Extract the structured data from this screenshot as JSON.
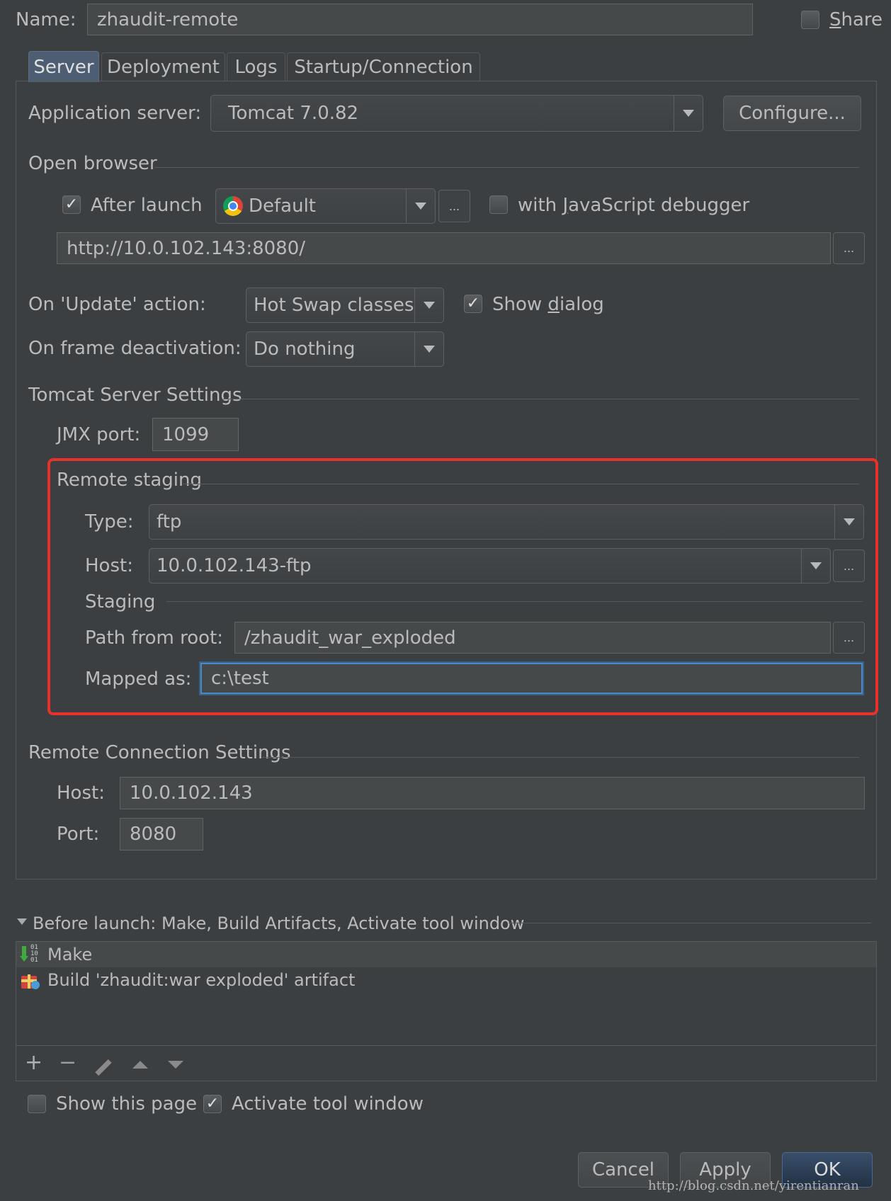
{
  "name": {
    "label": "Name:",
    "value": "zhaudit-remote"
  },
  "share": {
    "label_first": "S",
    "label_rest": "hare",
    "checked": false
  },
  "tabs": [
    {
      "label": "Server",
      "active": true
    },
    {
      "label": "Deployment",
      "active": false
    },
    {
      "label": "Logs",
      "active": false
    },
    {
      "label": "Startup/Connection",
      "active": false
    }
  ],
  "app_server": {
    "label": "Application server:",
    "value": "Tomcat 7.0.82",
    "configure_label": "Configure..."
  },
  "open_browser": {
    "section_label": "Open browser",
    "after_launch_label": "After launch",
    "after_launch_checked": true,
    "browser_value": "Default",
    "browser_icon": "chrome-icon",
    "ellipsis": "...",
    "js_debugger_pre": "with ",
    "js_debugger_u": "J",
    "js_debugger_post": "avaScript debugger",
    "js_debugger_checked": false,
    "url": "http://10.0.102.143:8080/"
  },
  "update_action": {
    "label": "On 'Update' action:",
    "value": "Hot Swap classes",
    "show_dialog_pre": "Show ",
    "show_dialog_u": "d",
    "show_dialog_post": "ialog",
    "show_dialog_checked": true
  },
  "frame_deactivation": {
    "label": "On frame deactivation:",
    "value": "Do nothing"
  },
  "tomcat_settings": {
    "section_label": "Tomcat Server Settings",
    "jmx_label": "JMX port:",
    "jmx_value": "1099"
  },
  "remote_staging": {
    "section_label": "Remote staging",
    "type_label": "Type:",
    "type_value": "ftp",
    "host_label": "Host:",
    "host_value": "10.0.102.143-ftp",
    "staging_label": "Staging",
    "path_label": "Path from root:",
    "path_value": "/zhaudit_war_exploded",
    "mapped_label": "Mapped as:",
    "mapped_value": "c:\\test",
    "highlight_color": "#e8312a"
  },
  "remote_connection": {
    "section_label": "Remote Connection Settings",
    "host_label": "Host:",
    "host_value": "10.0.102.143",
    "port_label": "Port:",
    "port_value": "8080"
  },
  "before_launch": {
    "header": "Before launch: Make, Build Artifacts, Activate tool window",
    "items": [
      {
        "label": "Make",
        "icon": "make-icon"
      },
      {
        "label": "Build 'zhaudit:war exploded' artifact",
        "icon": "artifact-icon"
      }
    ],
    "toolbar": {
      "add": "+",
      "remove": "−",
      "edit_icon": "pencil-icon",
      "up_icon": "arrow-up-icon",
      "down_icon": "arrow-down-icon"
    }
  },
  "show_this_page": {
    "label": "Show this page",
    "checked": false
  },
  "activate_tool_window": {
    "label": "Activate tool window",
    "checked": true
  },
  "buttons": {
    "cancel": "Cancel",
    "apply": "Apply",
    "ok": "OK"
  },
  "watermark": "http://blog.csdn.net/yirentianran",
  "colors": {
    "background": "#3c3f41",
    "field": "#45494a",
    "text": "#bbbbbb",
    "focus": "#4a88c7",
    "highlight": "#e8312a"
  }
}
